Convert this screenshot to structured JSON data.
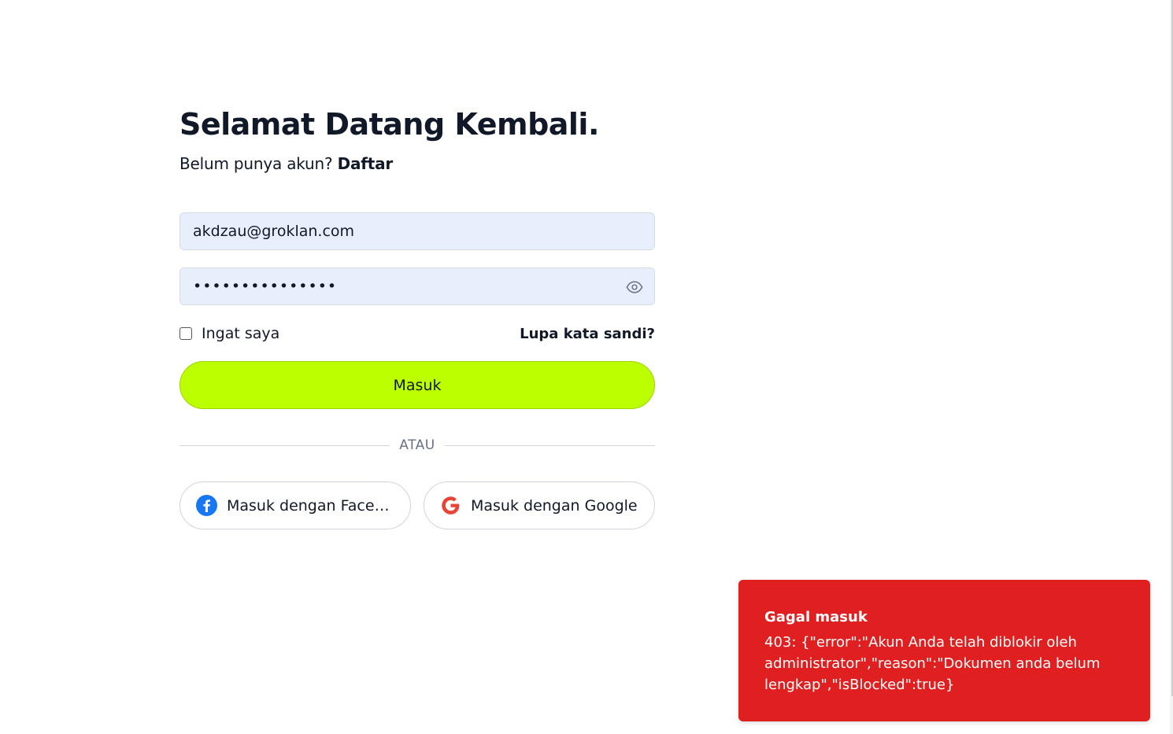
{
  "login": {
    "title": "Selamat Datang Kembali.",
    "subtitle_prefix": "Belum punya akun?",
    "signup_link": "Daftar",
    "email_value": "akdzau@groklan.com",
    "password_masked": "•••••••••••••••",
    "remember_label": "Ingat saya",
    "forgot_link": "Lupa kata sandi?",
    "submit_label": "Masuk",
    "divider_label": "ATAU",
    "facebook_label": "Masuk dengan Facebook",
    "google_label": "Masuk dengan Google",
    "accent_color": "#bbff00"
  },
  "toast": {
    "title": "Gagal masuk",
    "message": "403: {\"error\":\"Akun Anda telah diblokir oleh administrator\",\"reason\":\"Dokumen anda belum lengkap\",\"isBlocked\":true}",
    "color": "#e02020"
  }
}
